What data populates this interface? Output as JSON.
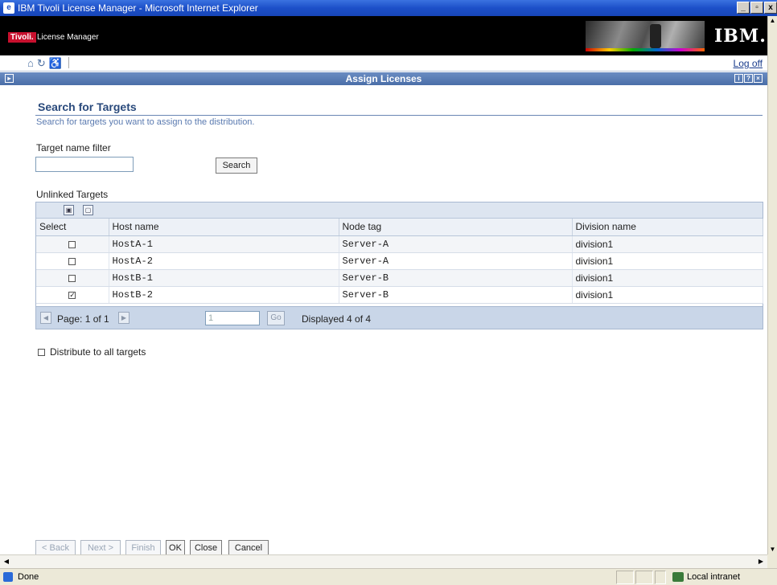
{
  "window": {
    "title": "IBM Tivoli License Manager - Microsoft Internet Explorer",
    "app_icon": "ie-icon",
    "controls": [
      "_",
      "▫",
      "x"
    ]
  },
  "banner": {
    "brand": "Tivoli.",
    "product": "License Manager",
    "company": "IBM."
  },
  "toolbar": {
    "icons": [
      "home-icon",
      "refresh-icon",
      "accessibility-icon"
    ],
    "logoff": "Log off"
  },
  "portlet": {
    "title": "Assign Licenses"
  },
  "section": {
    "title": "Search for Targets",
    "description": "Search for targets you want to assign to the distribution."
  },
  "filter": {
    "label": "Target name filter",
    "value": "",
    "search_button": "Search"
  },
  "table": {
    "caption": "Unlinked Targets",
    "columns": [
      "Select",
      "Host name",
      "Node tag",
      "Division name"
    ],
    "rows": [
      {
        "selected": false,
        "host": "HostA-1",
        "node": "Server-A",
        "division": "division1"
      },
      {
        "selected": false,
        "host": "HostA-2",
        "node": "Server-A",
        "division": "division1"
      },
      {
        "selected": false,
        "host": "HostB-1",
        "node": "Server-B",
        "division": "division1"
      },
      {
        "selected": true,
        "host": "HostB-2",
        "node": "Server-B",
        "division": "division1"
      }
    ],
    "pager": {
      "page_text": "Page: 1 of 1",
      "page_input": "1",
      "go": "Go",
      "displayed": "Displayed 4 of 4"
    }
  },
  "distribute_all": {
    "label": "Distribute to all targets",
    "checked": false
  },
  "wizard": {
    "back": "< Back",
    "next": "Next >",
    "finish": "Finish",
    "ok": "OK",
    "close": "Close",
    "cancel": "Cancel"
  },
  "status": {
    "text": "Done",
    "zone": "Local intranet"
  }
}
